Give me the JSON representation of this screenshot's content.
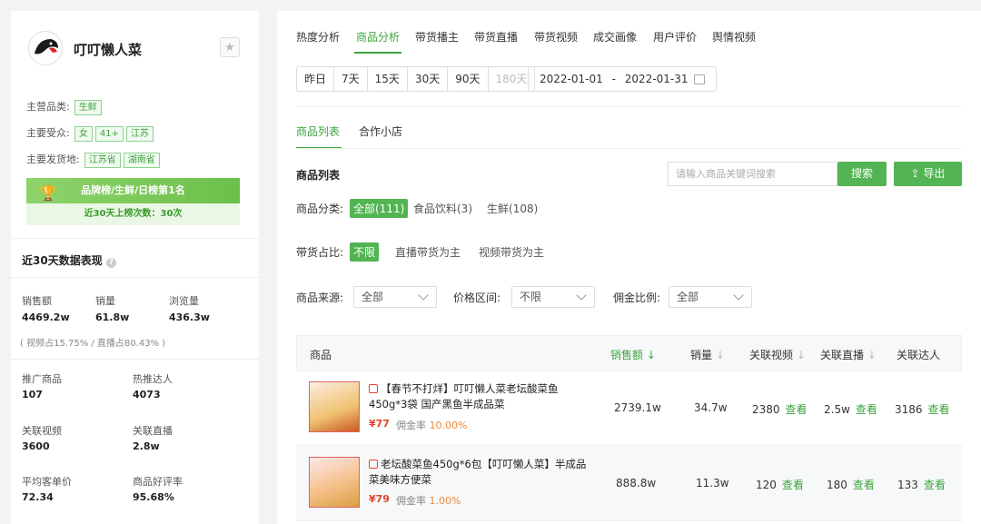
{
  "shop": {
    "name": "叮叮懒人菜",
    "main_category_label": "主营品类:",
    "main_category_tags": [
      "生鲜"
    ],
    "audience_label": "主要受众:",
    "audience_tags": [
      "女",
      "41+",
      "江苏"
    ],
    "ship_from_label": "主要发货地:",
    "ship_from_tags": [
      "江苏省",
      "湖南省"
    ],
    "rank_badge": "品牌榜/生鲜/日榜第1名",
    "rank_count": "近30天上榜次数：30次"
  },
  "perf": {
    "title": "近30天数据表现",
    "stats": [
      {
        "label": "销售额",
        "value": "4469.2w"
      },
      {
        "label": "销量",
        "value": "61.8w"
      },
      {
        "label": "浏览量",
        "value": "436.3w"
      }
    ],
    "note": "( 视频占15.75% /  直播占80.43% )",
    "grid": [
      {
        "label": "推广商品",
        "value": "107"
      },
      {
        "label": "热推达人",
        "value": "4073"
      },
      {
        "label": "关联视频",
        "value": "3600"
      },
      {
        "label": "关联直播",
        "value": "2.8w"
      },
      {
        "label": "平均客单价",
        "value": "72.34"
      },
      {
        "label": "商品好评率",
        "value": "95.68%"
      }
    ]
  },
  "tabs": [
    "热度分析",
    "商品分析",
    "带货播主",
    "带货直播",
    "带货视频",
    "成交画像",
    "用户评价",
    "舆情视频"
  ],
  "active_tab": "商品分析",
  "date_range_buttons": [
    "昨日",
    "7天",
    "15天",
    "30天",
    "90天",
    "180天"
  ],
  "date_range": {
    "start": "2022-01-01",
    "sep": "-",
    "end": "2022-01-31"
  },
  "subtabs": [
    "商品列表",
    "合作小店"
  ],
  "section_title": "商品列表",
  "search": {
    "placeholder": "请输入商品关键词搜索",
    "button": "搜索",
    "export": "导出"
  },
  "filters": {
    "category_label": "商品分类:",
    "category_options": [
      "全部(111)",
      "食品饮料(3)",
      "生鲜(108)"
    ],
    "ratio_label": "带货占比:",
    "ratio_options": [
      "不限",
      "直播带货为主",
      "视频带货为主"
    ],
    "source_label": "商品来源:",
    "source_value": "全部",
    "price_label": "价格区间:",
    "price_value": "不限",
    "commission_label": "佣金比例:",
    "commission_value": "全部"
  },
  "table": {
    "headers": [
      "商品",
      "销售额",
      "销量",
      "关联视频",
      "关联直播",
      "关联达人"
    ],
    "view_label": "查看",
    "commission_label": "佣金率",
    "rows": [
      {
        "name": "【春节不打烊】叮叮懒人菜老坛酸菜鱼450g*3袋 国产黑鱼半成品菜",
        "price": "¥77",
        "commission": "10.00%",
        "sales": "2739.1w",
        "volume": "34.7w",
        "videos": "2380",
        "lives": "2.5w",
        "kols": "3186"
      },
      {
        "name": "老坛酸菜鱼450g*6包【叮叮懒人菜】半成品菜美味方便菜",
        "price": "¥79",
        "commission": "1.00%",
        "sales": "888.8w",
        "volume": "11.3w",
        "videos": "120",
        "lives": "180",
        "kols": "133"
      }
    ]
  }
}
